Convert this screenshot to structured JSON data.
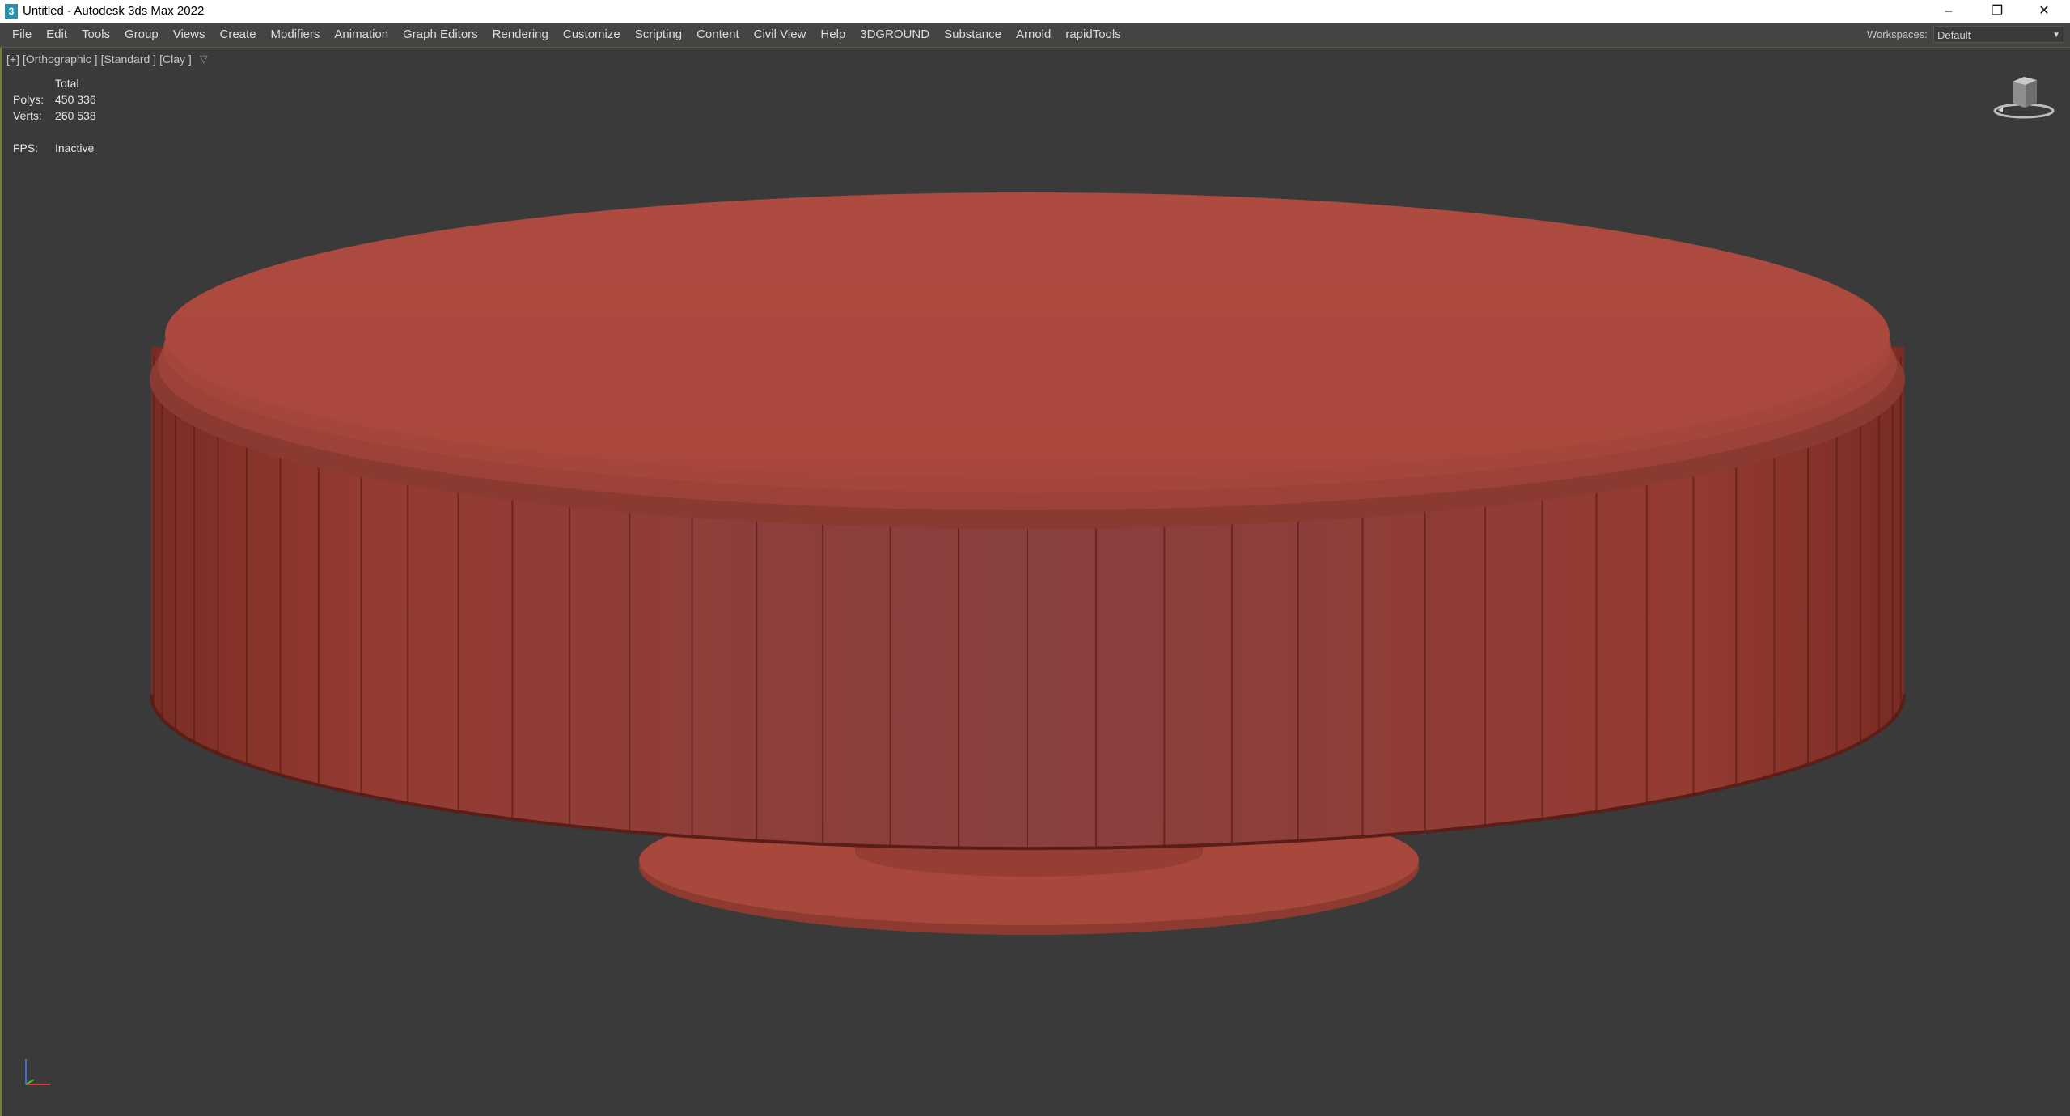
{
  "window": {
    "title": "Untitled - Autodesk 3ds Max 2022",
    "icon_text": "3",
    "minimize_icon": "minimize-icon",
    "restore_icon": "restore-icon",
    "close_icon": "close-icon"
  },
  "menu": {
    "items": [
      "File",
      "Edit",
      "Tools",
      "Group",
      "Views",
      "Create",
      "Modifiers",
      "Animation",
      "Graph Editors",
      "Rendering",
      "Customize",
      "Scripting",
      "Content",
      "Civil View",
      "Help",
      "3DGROUND",
      "Substance",
      "Arnold",
      "rapidTools"
    ],
    "workspaces_label": "Workspaces:",
    "workspace_value": "Default"
  },
  "viewport": {
    "labels": [
      "[+]",
      "[Orthographic ]",
      "[Standard ]",
      "[Clay ]"
    ],
    "stats": {
      "header": "Total",
      "polys_label": "Polys:",
      "polys_value": "450 336",
      "verts_label": "Verts:",
      "verts_value": "260 538",
      "fps_label": "FPS:",
      "fps_value": "Inactive"
    },
    "icons": [
      "filter-icon",
      "viewcube-icon",
      "axis-tripod-icon"
    ]
  },
  "colors": {
    "viewport_bg": "#3a3a3a",
    "clay": "#a94a3f",
    "active_border": "#7d7d3c"
  }
}
